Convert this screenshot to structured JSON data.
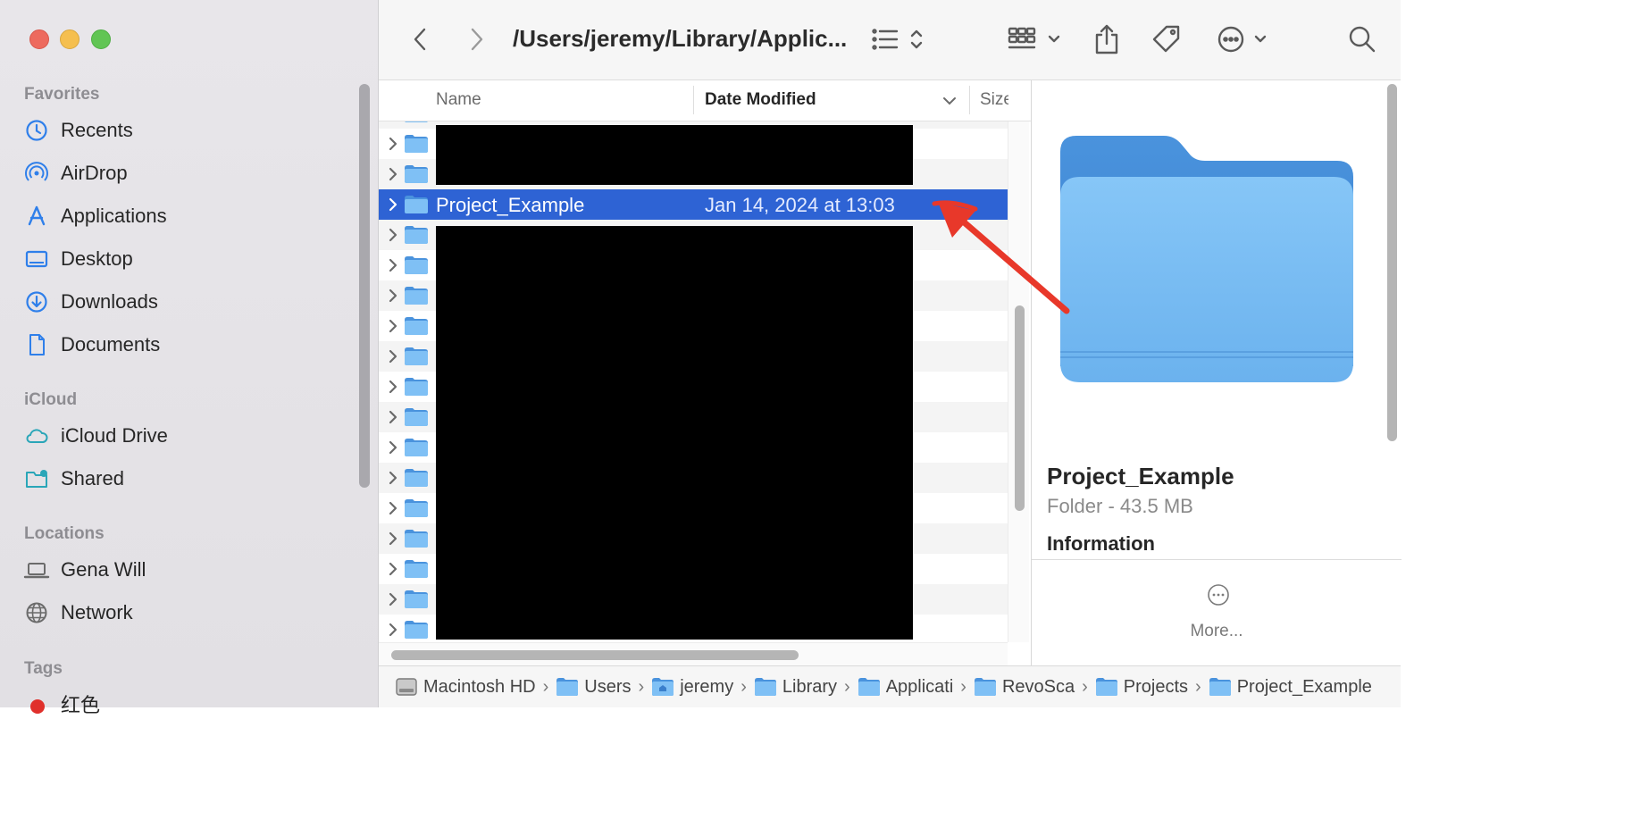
{
  "window": {
    "path_title": "/Users/jeremy/Library/Applic..."
  },
  "sidebar": {
    "favorites_label": "Favorites",
    "favorites": [
      {
        "label": "Recents",
        "icon": "clock-icon"
      },
      {
        "label": "AirDrop",
        "icon": "airdrop-icon"
      },
      {
        "label": "Applications",
        "icon": "applications-icon"
      },
      {
        "label": "Desktop",
        "icon": "desktop-icon"
      },
      {
        "label": "Downloads",
        "icon": "downloads-icon"
      },
      {
        "label": "Documents",
        "icon": "document-icon"
      }
    ],
    "icloud_label": "iCloud",
    "icloud": [
      {
        "label": "iCloud Drive",
        "icon": "cloud-icon"
      },
      {
        "label": "Shared",
        "icon": "shared-folder-icon"
      }
    ],
    "locations_label": "Locations",
    "locations": [
      {
        "label": "Gena Will",
        "icon": "laptop-icon"
      },
      {
        "label": "Network",
        "icon": "globe-icon"
      }
    ],
    "tags_label": "Tags",
    "tags": [
      {
        "label": "红色",
        "color": "#e0302b"
      }
    ]
  },
  "columns": {
    "name": "Name",
    "date_modified": "Date Modified",
    "size": "Size"
  },
  "selected_row": {
    "name": "Project_Example",
    "date": "Jan 14, 2024 at 13:03"
  },
  "preview": {
    "name": "Project_Example",
    "kind": "Folder - 43.5 MB",
    "info_heading": "Information",
    "more_label": "More..."
  },
  "pathbar": [
    {
      "label": "Macintosh HD",
      "icon": "disk-icon"
    },
    {
      "label": "Users",
      "icon": "folder-icon"
    },
    {
      "label": "jeremy",
      "icon": "home-folder-icon"
    },
    {
      "label": "Library",
      "icon": "folder-icon"
    },
    {
      "label": "Applicati",
      "icon": "folder-icon"
    },
    {
      "label": "RevoSca",
      "icon": "folder-icon"
    },
    {
      "label": "Projects",
      "icon": "folder-icon"
    },
    {
      "label": "Project_Example",
      "icon": "folder-icon"
    }
  ],
  "colors": {
    "accent": "#2e63d4",
    "folder": "#6cb4f0",
    "annotation": "#e8382a"
  }
}
